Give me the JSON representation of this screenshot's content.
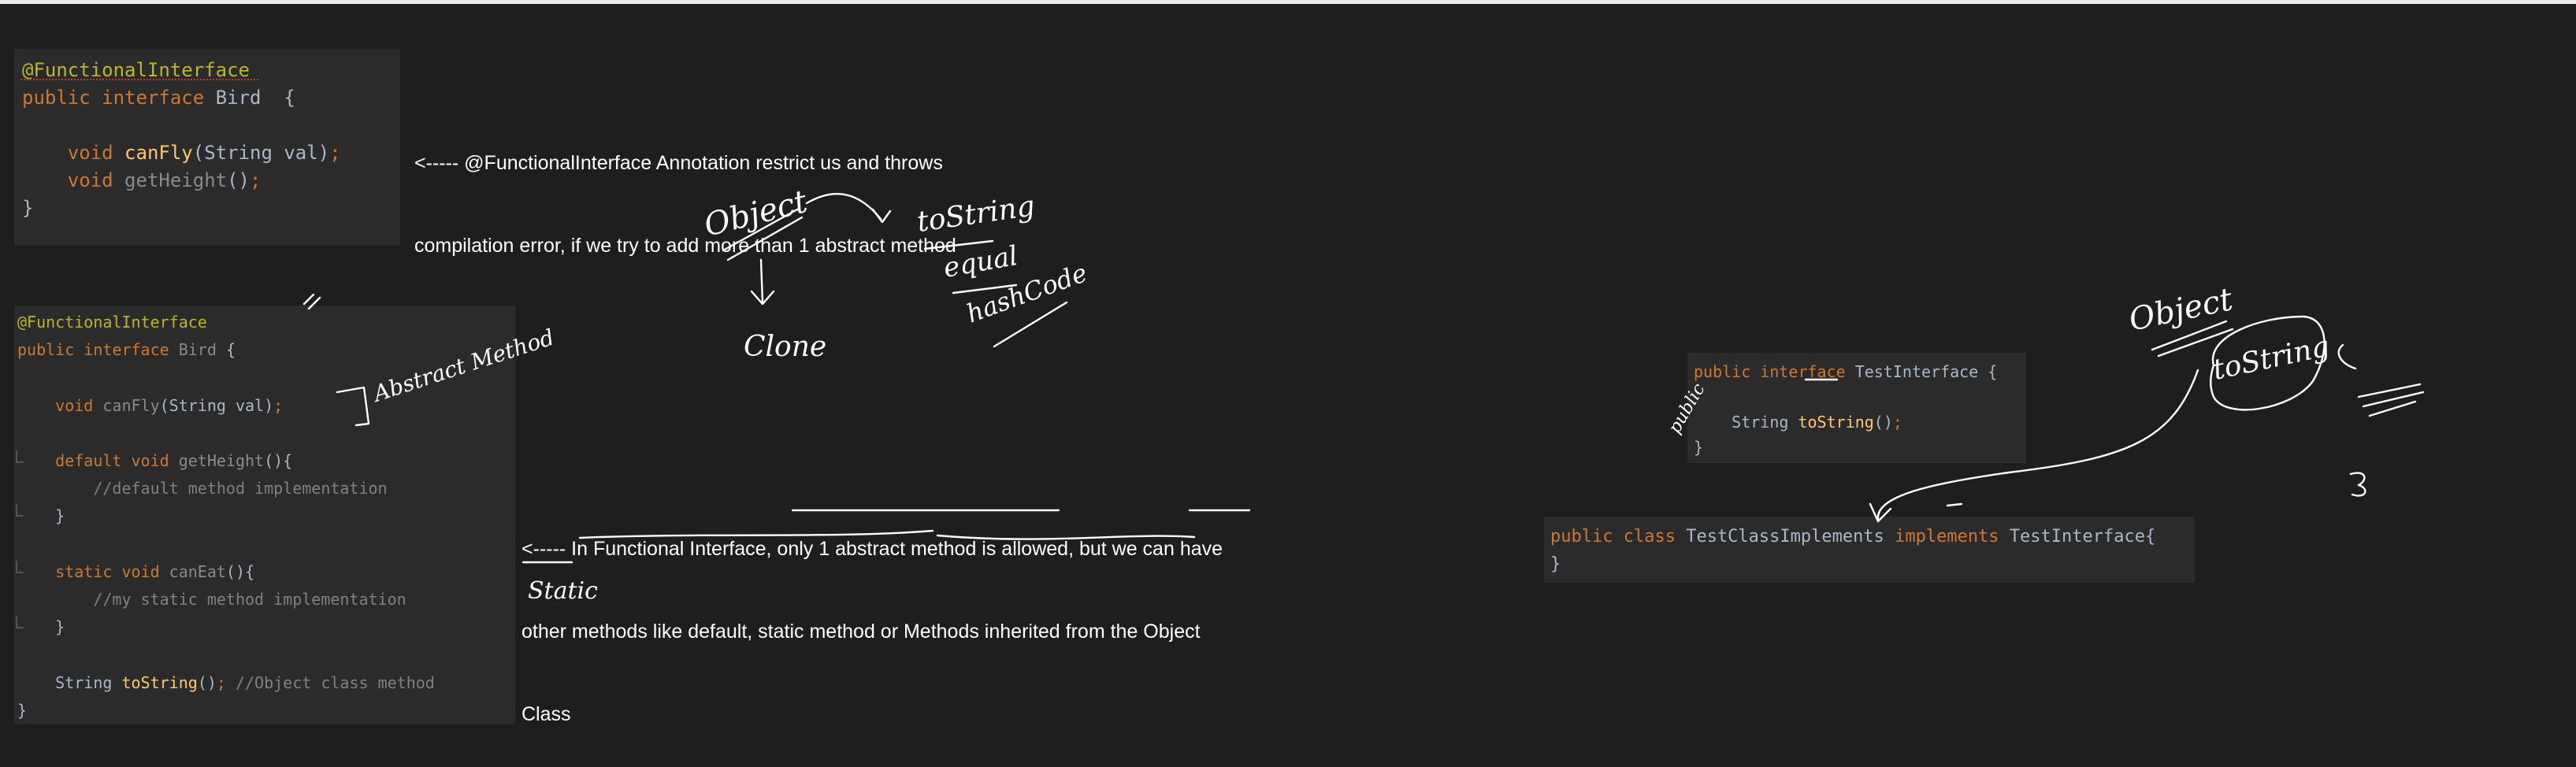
{
  "code_block_1": {
    "lines": [
      [
        {
          "t": "@FunctionalInterface",
          "c": "ann"
        }
      ],
      [
        {
          "t": "public ",
          "c": "kw"
        },
        {
          "t": "interface ",
          "c": "kw"
        },
        {
          "t": "Bird  {",
          "c": "txt"
        }
      ],
      [],
      [
        {
          "t": "    void ",
          "c": "kw"
        },
        {
          "t": "canFly",
          "c": "fn"
        },
        {
          "t": "(String val)",
          "c": "txt"
        },
        {
          "t": ";",
          "c": "kw"
        }
      ],
      [
        {
          "t": "    void ",
          "c": "kw"
        },
        {
          "t": "getHeight",
          "c": "dim"
        },
        {
          "t": "()",
          "c": "txt"
        },
        {
          "t": ";",
          "c": "kw"
        }
      ],
      [
        {
          "t": "}",
          "c": "txt"
        }
      ]
    ]
  },
  "code_block_2": {
    "lines": [
      [
        {
          "t": "@FunctionalInterface",
          "c": "ann"
        }
      ],
      [
        {
          "t": "public ",
          "c": "kw"
        },
        {
          "t": "interface ",
          "c": "kw"
        },
        {
          "t": "Bird ",
          "c": "dim"
        },
        {
          "t": "{",
          "c": "txt"
        }
      ],
      [],
      [
        {
          "t": "    void ",
          "c": "kw"
        },
        {
          "t": "canFly",
          "c": "dim"
        },
        {
          "t": "(String val)",
          "c": "txt"
        },
        {
          "t": ";",
          "c": "kw"
        }
      ],
      [],
      [
        {
          "t": "    default ",
          "c": "kw"
        },
        {
          "t": "void ",
          "c": "kw"
        },
        {
          "t": "getHeight",
          "c": "dim"
        },
        {
          "t": "(){",
          "c": "txt"
        }
      ],
      [
        {
          "t": "        //default method implementation",
          "c": "cmt"
        }
      ],
      [
        {
          "t": "    }",
          "c": "txt"
        }
      ],
      [],
      [
        {
          "t": "    static ",
          "c": "kw"
        },
        {
          "t": "void ",
          "c": "kw"
        },
        {
          "t": "canEat",
          "c": "dim"
        },
        {
          "t": "(){",
          "c": "txt"
        }
      ],
      [
        {
          "t": "        //my static method implementation",
          "c": "cmt"
        }
      ],
      [
        {
          "t": "    }",
          "c": "txt"
        }
      ],
      [],
      [
        {
          "t": "    String ",
          "c": "txt"
        },
        {
          "t": "toString",
          "c": "fn"
        },
        {
          "t": "()",
          "c": "txt"
        },
        {
          "t": "; ",
          "c": "kw"
        },
        {
          "t": "//Object class method",
          "c": "cmt"
        }
      ],
      [
        {
          "t": "}",
          "c": "txt"
        }
      ]
    ]
  },
  "code_block_3": {
    "lines": [
      [
        {
          "t": "public ",
          "c": "kw"
        },
        {
          "t": "interface ",
          "c": "kw"
        },
        {
          "t": "TestInterface {",
          "c": "txt"
        }
      ],
      [],
      [
        {
          "t": "    String ",
          "c": "txt"
        },
        {
          "t": "toString",
          "c": "fn"
        },
        {
          "t": "()",
          "c": "txt"
        },
        {
          "t": ";",
          "c": "kw"
        }
      ],
      [
        {
          "t": "}",
          "c": "txt"
        }
      ]
    ]
  },
  "code_block_4": {
    "lines": [
      [
        {
          "t": "public ",
          "c": "kw"
        },
        {
          "t": "class ",
          "c": "kw"
        },
        {
          "t": "TestClassImplements ",
          "c": "txt"
        },
        {
          "t": "implements ",
          "c": "kw"
        },
        {
          "t": "TestInterface{",
          "c": "txt"
        }
      ],
      [
        {
          "t": "}",
          "c": "txt"
        }
      ]
    ]
  },
  "note_1": {
    "line1": "<----- @FunctionalInterface Annotation restrict us and throws",
    "line2": "compilation error, if we try to add more than 1 abstract method"
  },
  "note_2": {
    "line1": "<----- In Functional Interface, only 1 abstract method is allowed, but we can have",
    "line2": "other methods like default, static method or Methods inherited from the Object",
    "line3": "Class"
  },
  "handwriting": {
    "abstract_method": "Abstract Method",
    "object_1": "Object",
    "tostring_1": "toString",
    "equal": "equal",
    "hashcode": "hashCode",
    "clone": "Clone",
    "static": "Static",
    "object_2": "Object",
    "tostring_2": "toString",
    "public_mark": "public"
  },
  "colors": {
    "background": "#1e1e1e",
    "editor": "#2b2b2b",
    "keyword": "#cc7832",
    "annotation": "#bbb529",
    "method": "#ffc66d",
    "comment": "#808080"
  }
}
